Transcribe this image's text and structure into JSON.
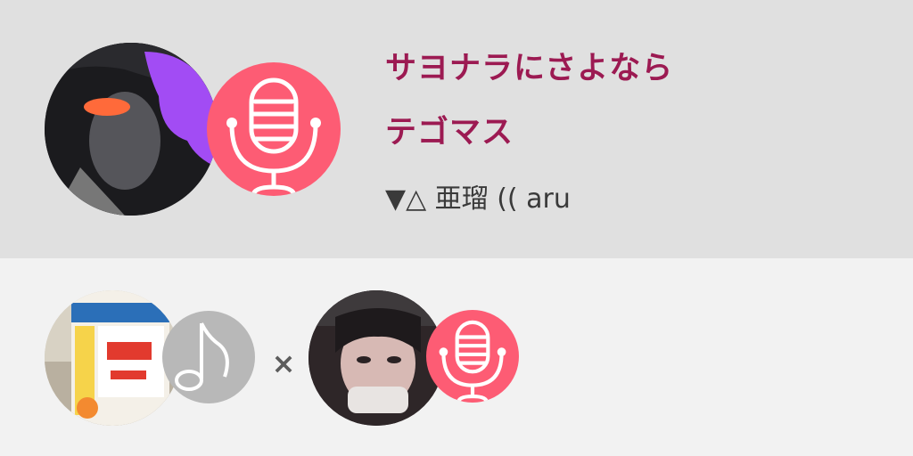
{
  "song": {
    "title": "サヨナラにさよなら",
    "artist": "テゴマス",
    "singer": "▼△ 亜瑠  (( aru"
  },
  "collab": {
    "separator": "×",
    "left_badge_icon": "music-note-icon",
    "right_badge_icon": "microphone-icon"
  },
  "icons": {
    "main_badge": "microphone-icon"
  },
  "colors": {
    "accent_text": "#9c1a52",
    "mic_badge": "#fd5c74",
    "note_badge": "#b8b8b8",
    "header_bg": "#e0e0e0",
    "footer_bg": "#f2f2f2"
  }
}
